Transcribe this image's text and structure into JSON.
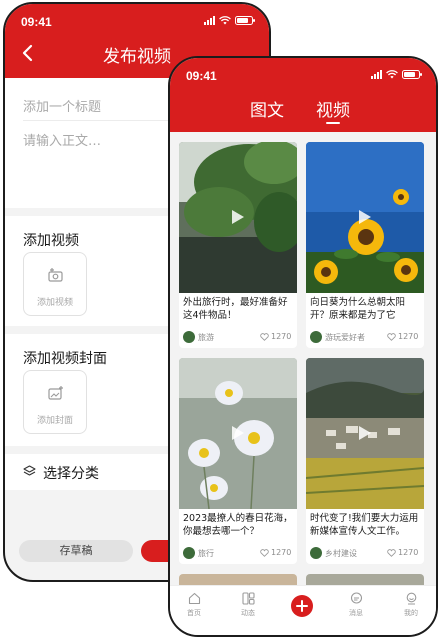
{
  "publish_screen": {
    "status_time": "09:41",
    "title": "发布视频",
    "title_placeholder": "添加一个标题",
    "body_placeholder": "请输入正文…",
    "add_video_label": "添加视频",
    "add_video_button": "添加视频",
    "add_cover_label": "添加视频封面",
    "add_cover_button": "添加封面",
    "category_label": "选择分类",
    "save_draft_button": "存草稿"
  },
  "feed_screen": {
    "status_time": "09:41",
    "tabs": [
      {
        "label": "图文",
        "active": false
      },
      {
        "label": "视频",
        "active": true
      }
    ],
    "cards": [
      {
        "title": "外出旅行时，最好准备好这4件物品！",
        "author": "旅游",
        "likes": "1270",
        "thumb": "leaves"
      },
      {
        "title": "向日葵为什么总朝太阳开？原来都是为了它",
        "author": "游玩爱好者",
        "likes": "1270",
        "thumb": "sunflower"
      },
      {
        "title": "2023最撩人的春日花海，你最想去哪一个？",
        "author": "旅行",
        "likes": "1270",
        "thumb": "daisy"
      },
      {
        "title": "时代变了!我们要大力运用新媒体宣传人文工作。",
        "author": "乡村建设",
        "likes": "1270",
        "thumb": "village"
      }
    ],
    "tabbar": [
      {
        "label": "首页",
        "icon": "home-icon"
      },
      {
        "label": "动态",
        "icon": "feed-icon"
      },
      {
        "label": "",
        "icon": "plus-icon"
      },
      {
        "label": "消息",
        "icon": "message-icon"
      },
      {
        "label": "我的",
        "icon": "profile-icon"
      }
    ]
  },
  "colors": {
    "brand_red": "#d81e1e",
    "background": "#f3f3f3"
  }
}
